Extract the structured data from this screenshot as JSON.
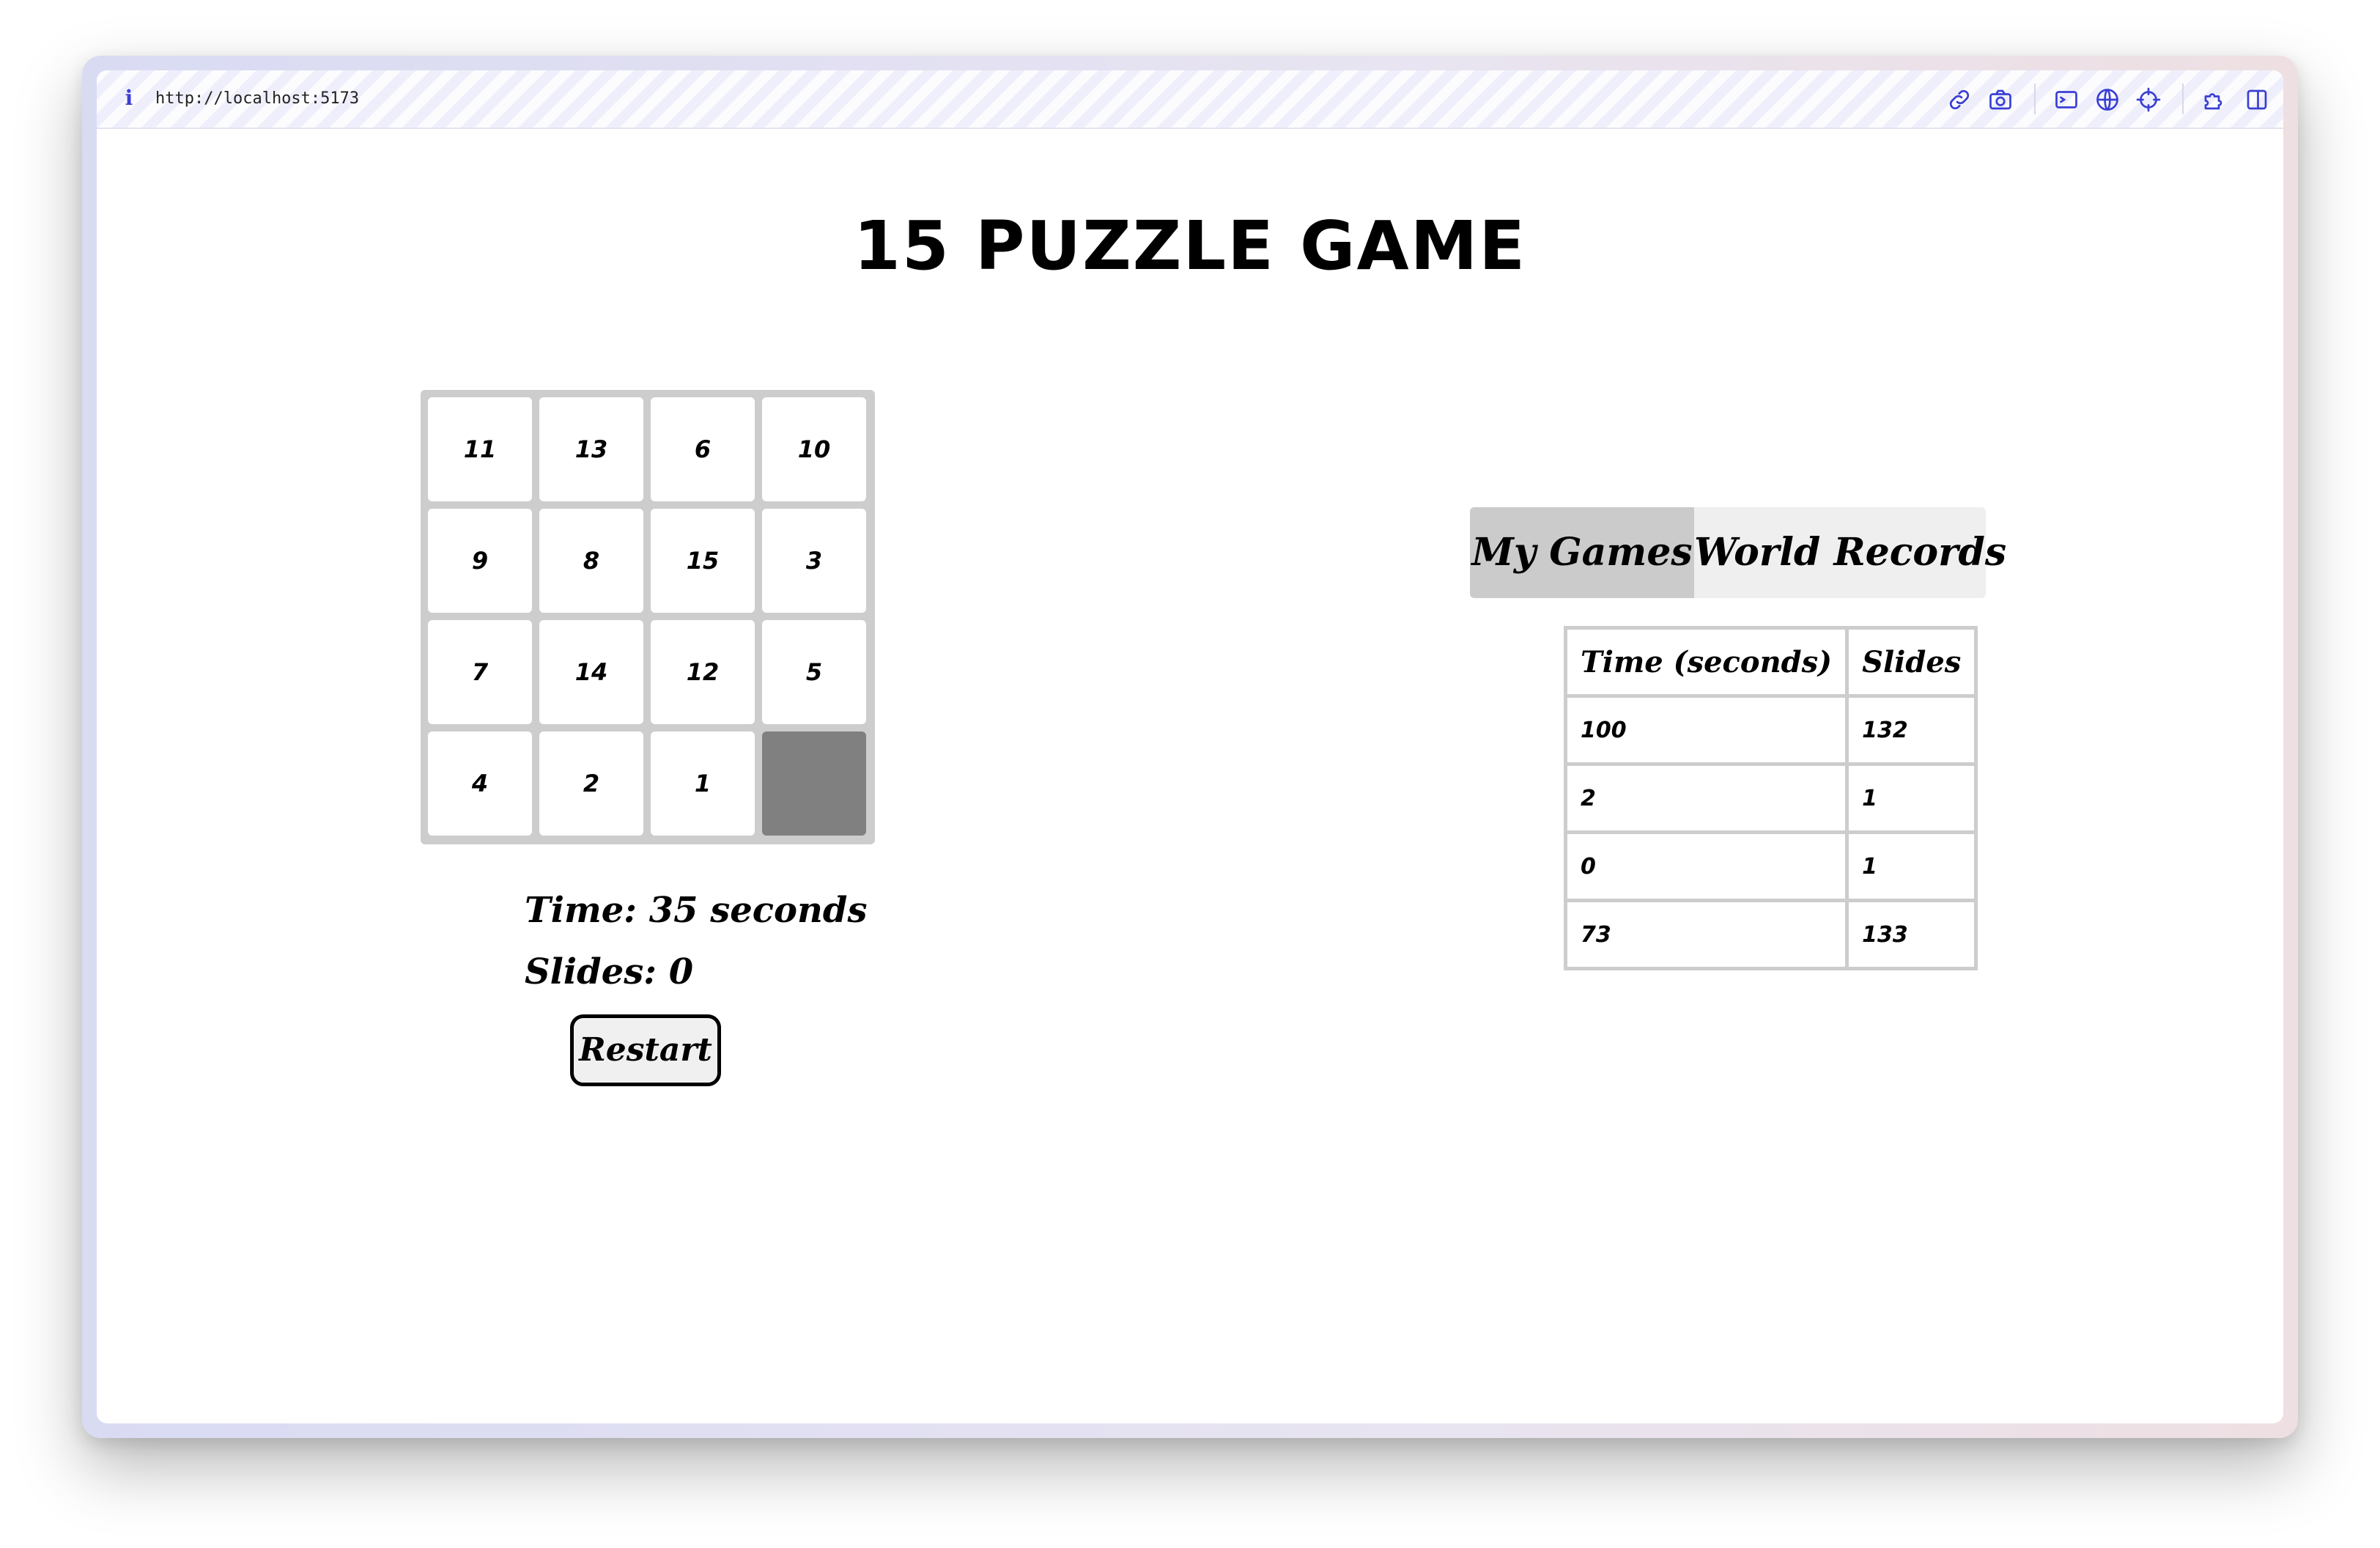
{
  "browser": {
    "url": "http://localhost:5173",
    "info_icon": "i",
    "icons": [
      "link-icon",
      "camera-icon",
      "terminal-icon",
      "globe-icon",
      "crosshair-icon",
      "extension-icon",
      "sidebar-icon"
    ]
  },
  "game": {
    "title": "15 PUZZLE GAME",
    "tiles": [
      "11",
      "13",
      "6",
      "10",
      "9",
      "8",
      "15",
      "3",
      "7",
      "14",
      "12",
      "5",
      "4",
      "2",
      "1",
      ""
    ],
    "time_text": "Time: 35 seconds",
    "slides_text": "Slides: 0",
    "restart_label": "Restart"
  },
  "records": {
    "tabs": [
      {
        "label": "My Games",
        "active": true
      },
      {
        "label": "World Records",
        "active": false
      }
    ],
    "columns": [
      "Time (seconds)",
      "Slides"
    ],
    "rows": [
      [
        "100",
        "132"
      ],
      [
        "2",
        "1"
      ],
      [
        "0",
        "1"
      ],
      [
        "73",
        "133"
      ]
    ]
  },
  "colors": {
    "accent_icon": "#3a3fd4",
    "board_background": "#cdcdcd",
    "empty_tile": "#808080",
    "active_tab": "#cbcbcb",
    "inactive_tab": "#efefef"
  }
}
